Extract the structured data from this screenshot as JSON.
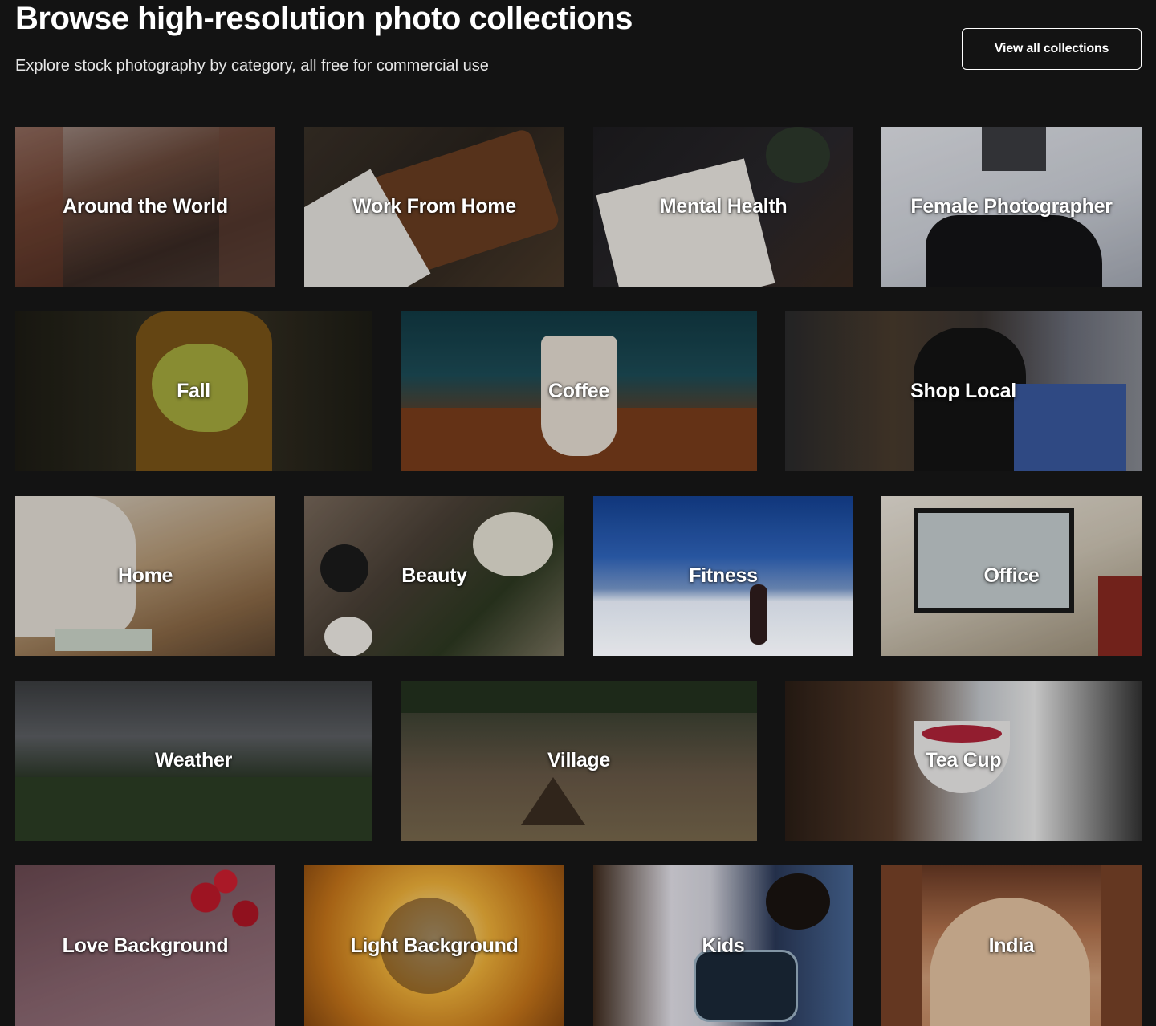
{
  "header": {
    "title": "Browse high-resolution photo collections",
    "subtitle": "Explore stock photography by category, all free for commercial use",
    "view_all_label": "View all collections"
  },
  "collections": [
    {
      "label": "Around the World"
    },
    {
      "label": "Work From Home"
    },
    {
      "label": "Mental Health"
    },
    {
      "label": "Female Photographer"
    },
    {
      "label": "Fall"
    },
    {
      "label": "Coffee"
    },
    {
      "label": "Shop Local"
    },
    {
      "label": "Home"
    },
    {
      "label": "Beauty"
    },
    {
      "label": "Fitness"
    },
    {
      "label": "Office"
    },
    {
      "label": "Weather"
    },
    {
      "label": "Village"
    },
    {
      "label": "Tea Cup"
    },
    {
      "label": "Love Background"
    },
    {
      "label": "Light Background"
    },
    {
      "label": "Kids"
    },
    {
      "label": "India"
    }
  ],
  "colors": {
    "page_background": "#131313",
    "text": "#ffffff",
    "button_border": "#ffffff"
  }
}
